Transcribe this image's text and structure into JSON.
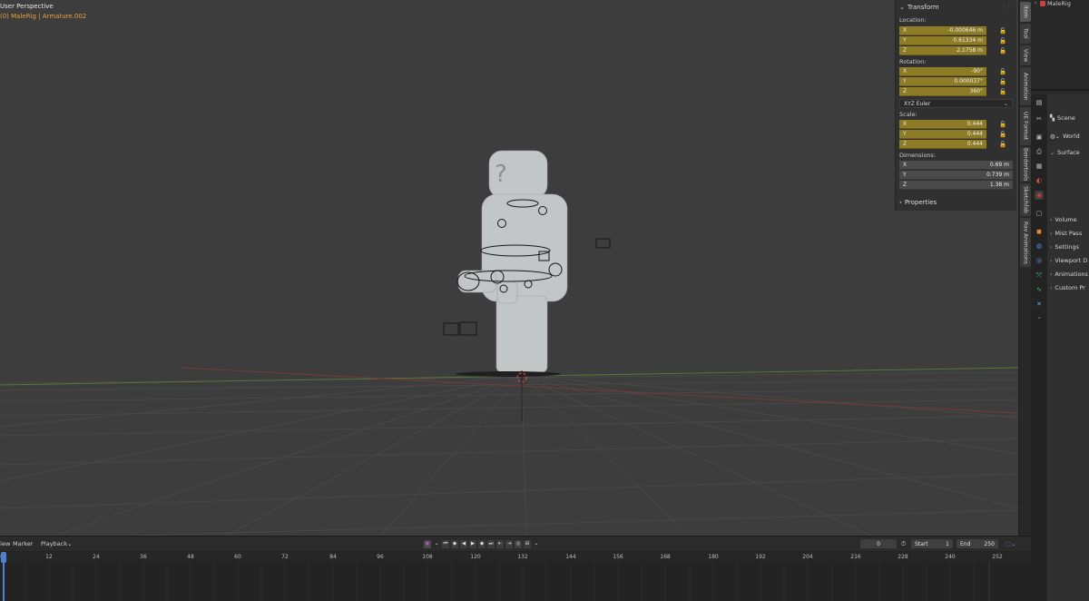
{
  "viewport": {
    "title": "User Perspective",
    "object_prefix": "(0) MaleRig",
    "object_sep": "|",
    "object_active": "Armature.002"
  },
  "npanel": {
    "header": "Transform",
    "location_label": "Location:",
    "location": [
      {
        "axis": "X",
        "value": "-0.000646 m"
      },
      {
        "axis": "Y",
        "value": "0.61334 m"
      },
      {
        "axis": "Z",
        "value": "2.1758 m"
      }
    ],
    "rotation_label": "Rotation:",
    "rotation": [
      {
        "axis": "X",
        "value": "-90°"
      },
      {
        "axis": "Y",
        "value": "0.000037°"
      },
      {
        "axis": "Z",
        "value": "360°"
      }
    ],
    "rotation_mode": "XYZ Euler",
    "scale_label": "Scale:",
    "scale": [
      {
        "axis": "X",
        "value": "0.444"
      },
      {
        "axis": "Y",
        "value": "0.444"
      },
      {
        "axis": "Z",
        "value": "0.444"
      }
    ],
    "dimensions_label": "Dimensions:",
    "dimensions": [
      {
        "axis": "X",
        "value": "0.69 m"
      },
      {
        "axis": "Y",
        "value": "0.739 m"
      },
      {
        "axis": "Z",
        "value": "1.38 m"
      }
    ],
    "properties_label": "Properties"
  },
  "vtabs": [
    "Item",
    "Tool",
    "View",
    "Animation",
    "UE Format",
    "Bendertools",
    "Sketchfab",
    "Rav Animations"
  ],
  "outliner": {
    "item": "MaleRig"
  },
  "properties": {
    "scene_label": "Scene",
    "world_label": "World",
    "surface_label": "Surface",
    "sections": [
      "Volume",
      "Mist Pass",
      "Settings",
      "Viewport D",
      "Animations",
      "Custom Pr"
    ]
  },
  "timeline": {
    "menus": [
      "View",
      "Marker",
      "Playback"
    ],
    "current_frame": "0",
    "start_label": "Start",
    "start_value": "1",
    "end_label": "End",
    "end_value": "250",
    "ruler_ticks": [
      "0",
      "12",
      "24",
      "36",
      "48",
      "60",
      "72",
      "84",
      "96",
      "108",
      "120",
      "132",
      "144",
      "156",
      "168",
      "180",
      "192",
      "204",
      "216",
      "228",
      "240",
      "252"
    ]
  }
}
